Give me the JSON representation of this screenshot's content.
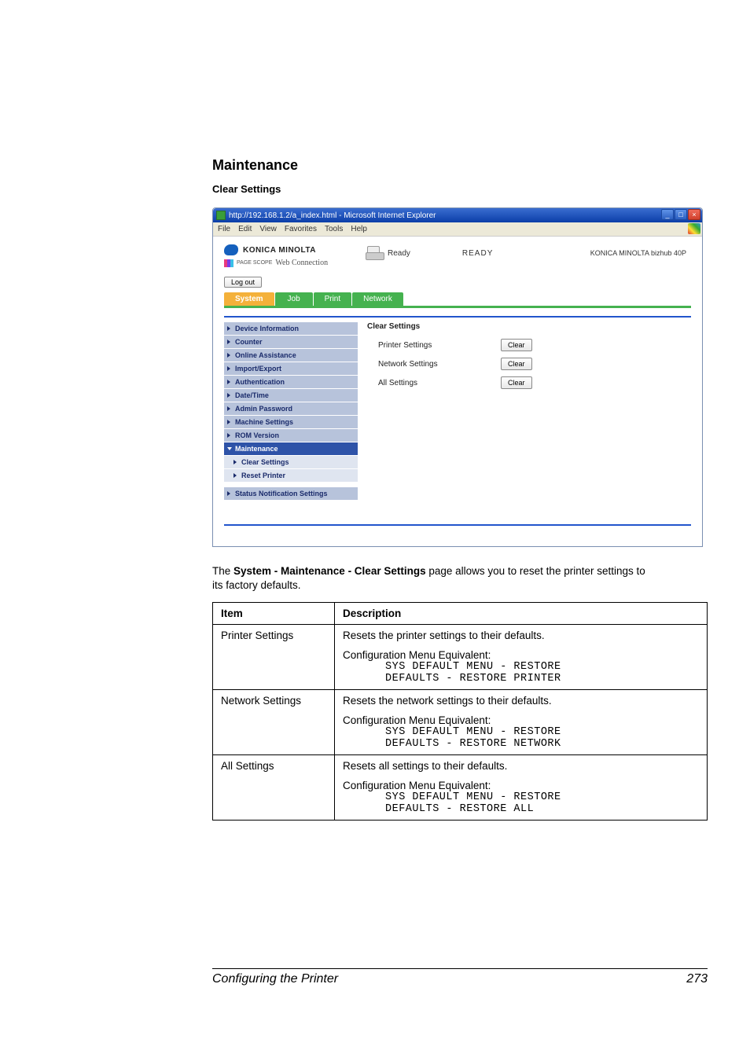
{
  "headings": {
    "maintenance": "Maintenance",
    "clear_settings": "Clear Settings"
  },
  "browser": {
    "title": "http://192.168.1.2/a_index.html - Microsoft Internet Explorer",
    "menus": [
      "File",
      "Edit",
      "View",
      "Favorites",
      "Tools",
      "Help"
    ],
    "win_min": "_",
    "win_max": "□",
    "win_close": "×"
  },
  "webconn": {
    "brand": "KONICA MINOLTA",
    "pagescope_small": "PAGE SCOPE",
    "wc_label": "Web Connection",
    "status_word": "Ready",
    "status_big": "READY",
    "model": "KONICA MINOLTA bizhub 40P",
    "logout": "Log out",
    "tabs": [
      {
        "label": "System",
        "active": true
      },
      {
        "label": "Job",
        "active": false
      },
      {
        "label": "Print",
        "active": false
      },
      {
        "label": "Network",
        "active": false
      }
    ],
    "side": [
      {
        "label": "Device Information"
      },
      {
        "label": "Counter"
      },
      {
        "label": "Online Assistance"
      },
      {
        "label": "Import/Export"
      },
      {
        "label": "Authentication"
      },
      {
        "label": "Date/Time"
      },
      {
        "label": "Admin Password"
      },
      {
        "label": "Machine Settings"
      },
      {
        "label": "ROM Version"
      }
    ],
    "side_open": "Maintenance",
    "side_subs": [
      {
        "label": "Clear Settings"
      },
      {
        "label": "Reset Printer"
      }
    ],
    "side_after": [
      {
        "label": "Status Notification Settings"
      }
    ],
    "pane": {
      "title": "Clear Settings",
      "rows": [
        {
          "label": "Printer Settings",
          "btn": "Clear"
        },
        {
          "label": "Network Settings",
          "btn": "Clear"
        },
        {
          "label": "All Settings",
          "btn": "Clear"
        }
      ]
    }
  },
  "paragraph": {
    "pre": "The ",
    "bold": "System - Maintenance - Clear Settings",
    "post": " page allows you to reset the printer settings to its factory defaults."
  },
  "table": {
    "head_item": "Item",
    "head_desc": "Description",
    "rows": [
      {
        "item": "Printer Settings",
        "desc": "Resets the printer settings to their defaults.",
        "cfg": "Configuration Menu Equivalent:",
        "mono1": "SYS DEFAULT MENU - RESTORE",
        "mono2": "DEFAULTS - RESTORE PRINTER"
      },
      {
        "item": "Network Settings",
        "desc": "Resets the network settings to their defaults.",
        "cfg": "Configuration Menu Equivalent:",
        "mono1": "SYS DEFAULT MENU - RESTORE",
        "mono2": "DEFAULTS - RESTORE NETWORK"
      },
      {
        "item": "All Settings",
        "desc": "Resets all settings to their defaults.",
        "cfg": "Configuration Menu Equivalent:",
        "mono1": "SYS DEFAULT MENU - RESTORE",
        "mono2": "DEFAULTS - RESTORE ALL"
      }
    ]
  },
  "footer": {
    "left": "Configuring the Printer",
    "right": "273"
  }
}
